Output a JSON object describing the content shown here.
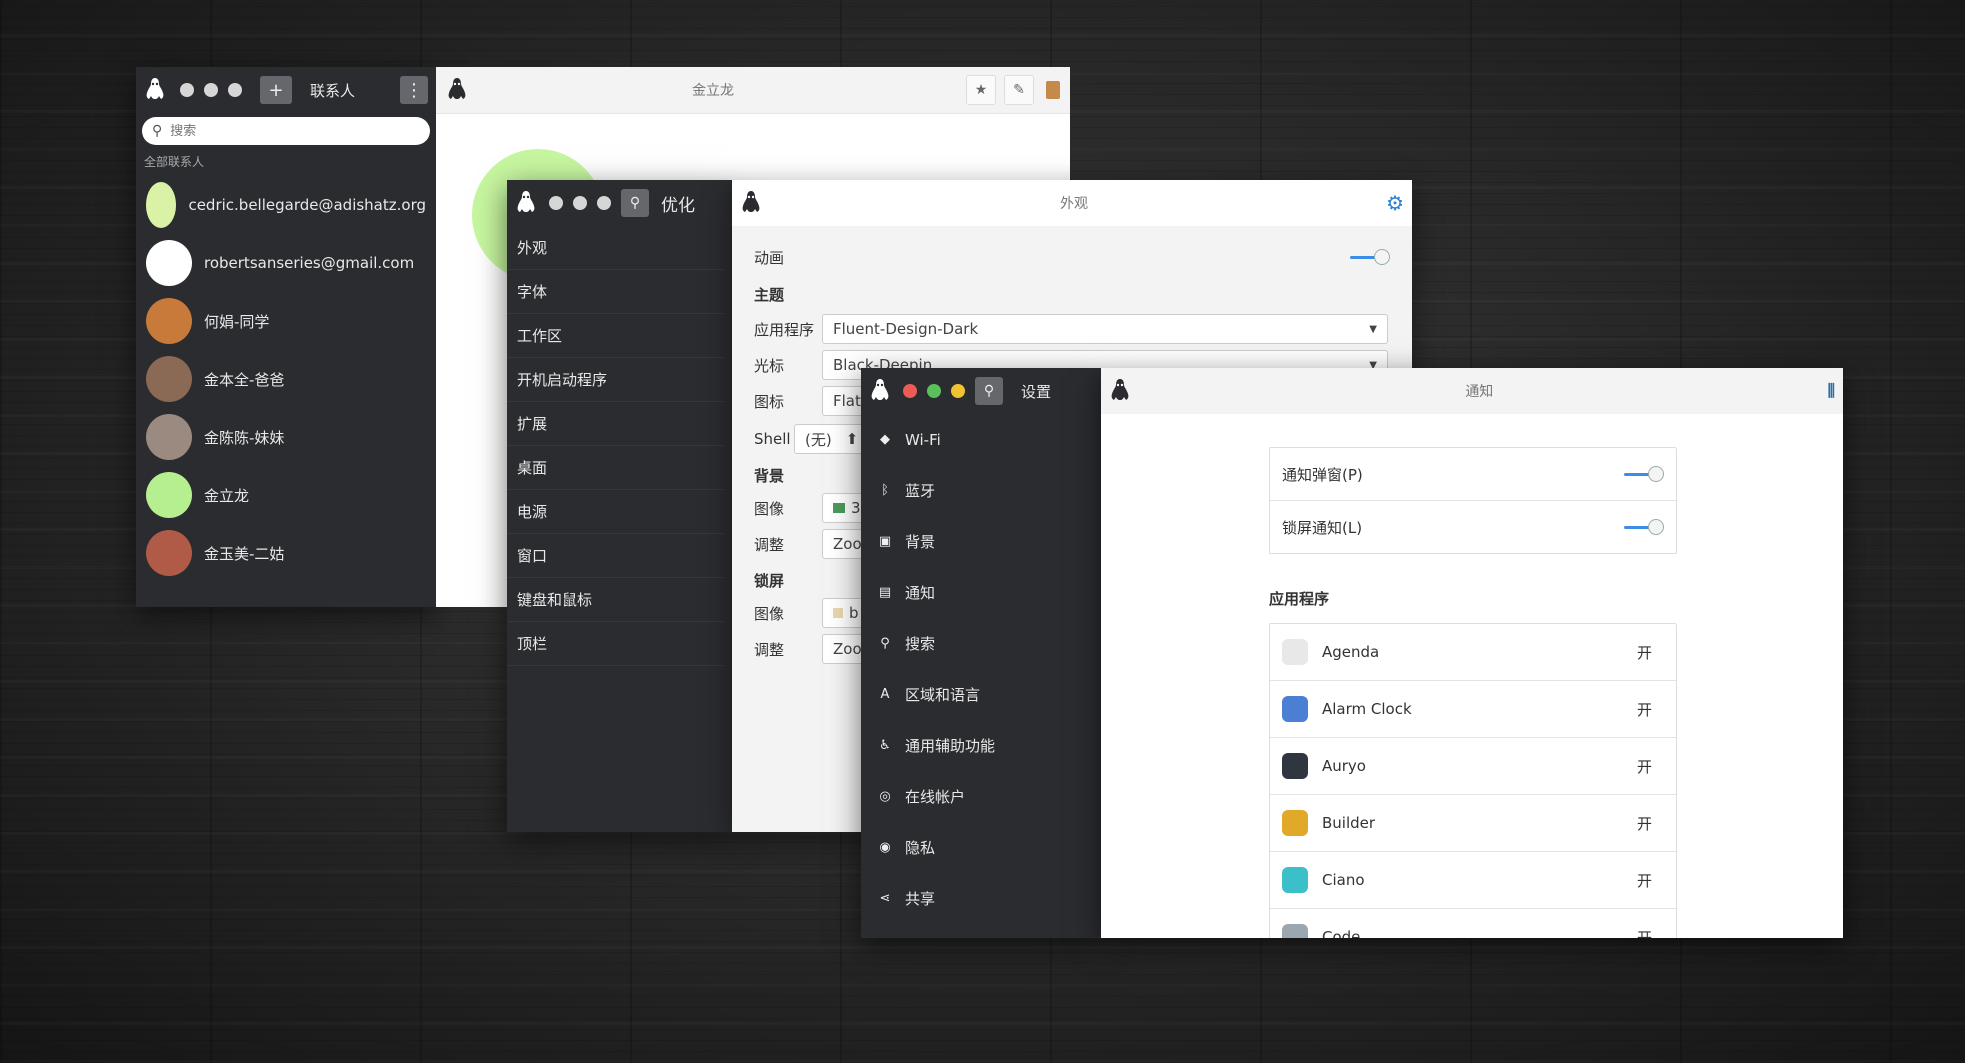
{
  "contacts": {
    "title": "联系人",
    "search_placeholder": "搜索",
    "section_label": "全部联系人",
    "items": [
      {
        "name": "cedric.bellegarde@adishatz.org",
        "avatar": "#d9f2a6"
      },
      {
        "name": "robertsanseries@gmail.com",
        "avatar": "#ffffff"
      },
      {
        "name": "何娟-同学",
        "avatar": "#c77a3a"
      },
      {
        "name": "金本全-爸爸",
        "avatar": "#8a6a55"
      },
      {
        "name": "金陈陈-妹妹",
        "avatar": "#9a8a80"
      },
      {
        "name": "金立龙",
        "avatar": "#b6ef8f"
      },
      {
        "name": "金玉美-二姑",
        "avatar": "#b05a48"
      }
    ],
    "detail_title": "金立龙"
  },
  "tweaks": {
    "title": "优化",
    "panel_title": "外观",
    "nav": [
      "外观",
      "字体",
      "工作区",
      "开机启动程序",
      "扩展",
      "桌面",
      "电源",
      "窗口",
      "键盘和鼠标",
      "顶栏"
    ],
    "animation_label": "动画",
    "theme_header": "主题",
    "app_label": "应用程序",
    "app_value": "Fluent-Design-Dark",
    "cursor_label": "光标",
    "cursor_value": "Black-Deepin",
    "icon_label": "图标",
    "icon_value": "Flat",
    "shell_label": "Shell",
    "shell_value": "(无)",
    "bg_header": "背景",
    "image_label": "图像",
    "image_value": "3",
    "adjust_label": "调整",
    "adjust_value": "Zoo",
    "lock_header": "锁屏",
    "lock_image_label": "图像",
    "lock_image_value": "b",
    "lock_adjust_label": "调整",
    "lock_adjust_value": "Zoo"
  },
  "settings": {
    "title": "设置",
    "panel_title": "通知",
    "nav": [
      {
        "label": "Wi-Fi",
        "icon": "wifi-icon",
        "glyph": "◆"
      },
      {
        "label": "蓝牙",
        "icon": "bluetooth-icon",
        "glyph": "ᛒ"
      },
      {
        "label": "背景",
        "icon": "background-icon",
        "glyph": "▣"
      },
      {
        "label": "通知",
        "icon": "notification-icon",
        "glyph": "▤"
      },
      {
        "label": "搜索",
        "icon": "search-icon",
        "glyph": "⚲"
      },
      {
        "label": "区域和语言",
        "icon": "region-icon",
        "glyph": "A"
      },
      {
        "label": "通用辅助功能",
        "icon": "accessibility-icon",
        "glyph": "♿"
      },
      {
        "label": "在线帐户",
        "icon": "online-accounts-icon",
        "glyph": "◎"
      },
      {
        "label": "隐私",
        "icon": "privacy-icon",
        "glyph": "◉"
      },
      {
        "label": "共享",
        "icon": "share-icon",
        "glyph": "⋖"
      }
    ],
    "popup_label": "通知弹窗(P)",
    "lockscreen_label": "锁屏通知(L)",
    "apps_header": "应用程序",
    "apps": [
      {
        "name": "Agenda",
        "state": "开",
        "color": "#e8e8e8"
      },
      {
        "name": "Alarm Clock",
        "state": "开",
        "color": "#4a7fd4"
      },
      {
        "name": "Auryo",
        "state": "开",
        "color": "#2f3640"
      },
      {
        "name": "Builder",
        "state": "开",
        "color": "#e0a92a"
      },
      {
        "name": "Ciano",
        "state": "开",
        "color": "#3cc0c8"
      },
      {
        "name": "Code",
        "state": "开",
        "color": "#9aa6b0"
      }
    ]
  }
}
